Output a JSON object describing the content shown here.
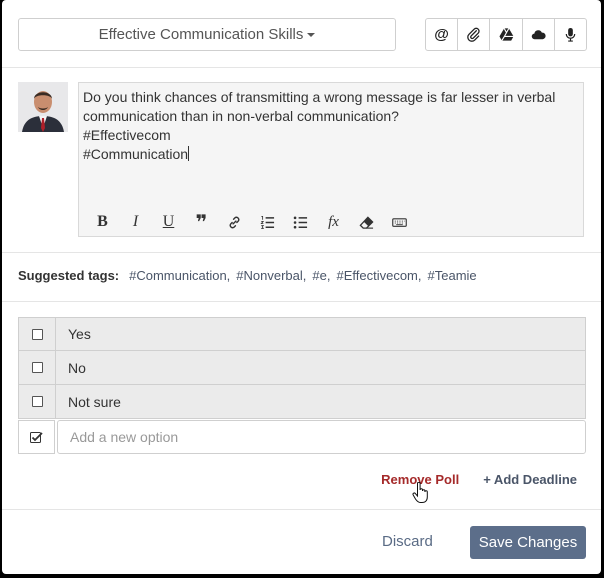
{
  "header": {
    "topic_label": "Effective Communication Skills",
    "icons": [
      "at-icon",
      "paperclip-icon",
      "google-drive-icon",
      "cloud-icon",
      "microphone-icon"
    ],
    "at_symbol": "@"
  },
  "editor": {
    "question": "Do you think chances of transmitting a wrong message is far lesser in verbal communication than in non-verbal communication?",
    "hashtag_1": "#Effectivecom",
    "hashtag_2": "#Communication",
    "toolbar": {
      "bold": "B",
      "italic": "I",
      "underline": "U",
      "quote": "❞",
      "formula": "fx"
    }
  },
  "suggested_tags": {
    "label": "Suggested tags:",
    "tags": [
      "#Communication,",
      "#Nonverbal,",
      "#e,",
      "#Effectivecom,",
      "#Teamie"
    ]
  },
  "poll": {
    "options": [
      "Yes",
      "No",
      "Not sure"
    ],
    "new_option_placeholder": "Add a new option"
  },
  "actions": {
    "remove_poll": "Remove Poll",
    "add_deadline": "+ Add Deadline"
  },
  "footer": {
    "discard": "Discard",
    "save": "Save Changes"
  },
  "colors": {
    "remove_poll": "#a52a2a",
    "primary_button": "#5c6e8a",
    "link": "#4a5568"
  }
}
